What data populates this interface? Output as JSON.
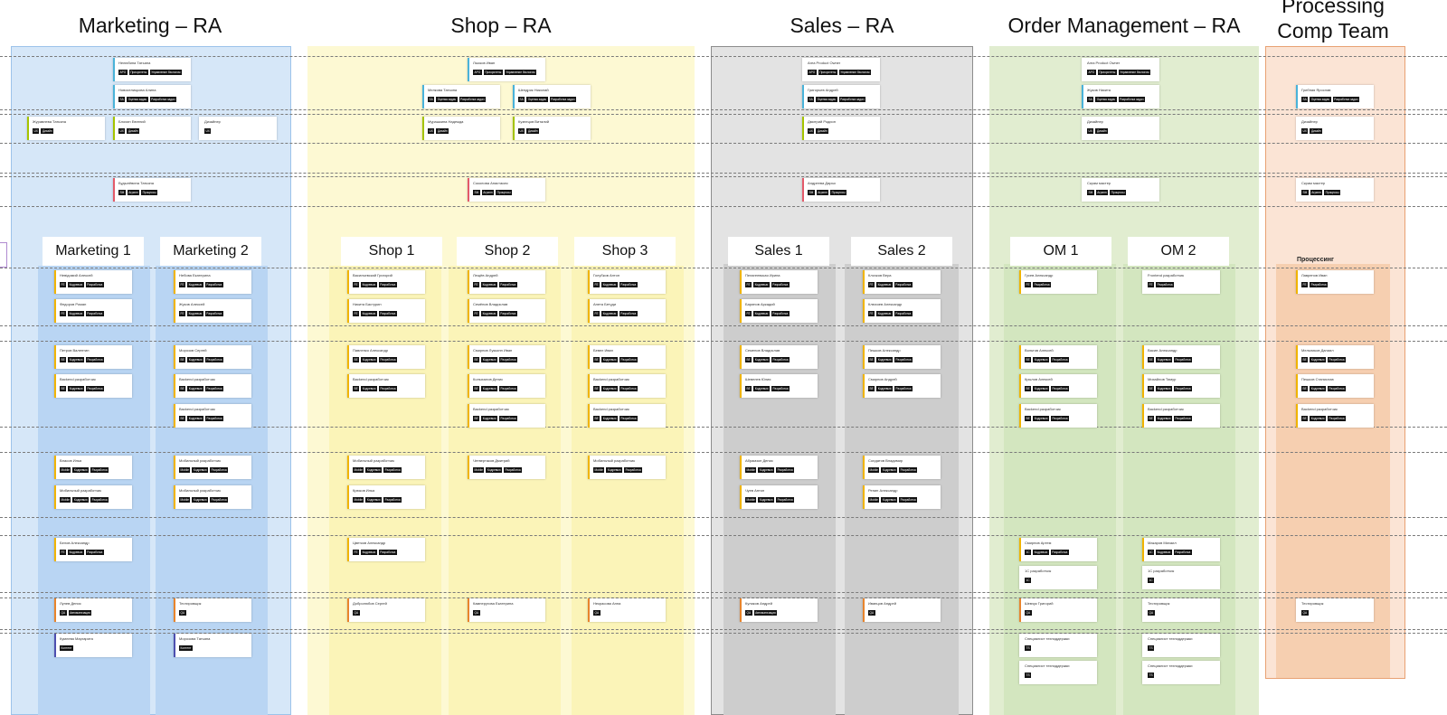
{
  "columns": [
    {
      "title": "Marketing – RA",
      "color": "#d6e7f8",
      "lane_color": "#bdd8f4"
    },
    {
      "title": "Shop – RA",
      "color": "#fdf9d3",
      "lane_color": "#fbf4b8"
    },
    {
      "title": "Sales – RA",
      "color": "#e3e3e3",
      "lane_color": "#cdcdcd"
    },
    {
      "title": "Order Management – RA",
      "color": "#e1edd0",
      "lane_color": "#d3e6bf"
    },
    {
      "title": "Processing Comp Team",
      "color": "#fbe4d5",
      "lane_color": "#f6cfb0"
    }
  ],
  "teams": [
    "Marketing 1",
    "Marketing 2",
    "Shop 1",
    "Shop 2",
    "Shop 3",
    "Sales 1",
    "Sales 2",
    "OM 1",
    "OM 2"
  ],
  "processing_label": "Процессинг",
  "cards": [
    {
      "name": "Нелюбина Татьяна",
      "tags": [
        "APO",
        "Приоритеты",
        "Управление бэклогом"
      ],
      "border": "#4ab3d9"
    },
    {
      "name": "Новоселицкова Алина",
      "tags": [
        "SA",
        "Оценка задач",
        "Разработка задач"
      ],
      "border": "#4ab3d9"
    },
    {
      "name": "Журавлева Татьяна",
      "tags": [
        "UX",
        "Дизайн"
      ],
      "border": "#a5c400"
    },
    {
      "name": "Блохин Евгений",
      "tags": [
        "UX",
        "Дизайн"
      ],
      "border": "#a5c400"
    },
    {
      "name": "Дизайнер",
      "tags": [
        "UX"
      ],
      "border": "#ffffff"
    },
    {
      "name": "Будылёвина Татьяна",
      "tags": [
        "SM",
        "Агрипн",
        "Процессы"
      ],
      "border": "#e35a6a"
    },
    {
      "name": "Лысков Иван",
      "tags": [
        "APO",
        "Приоритеты",
        "Управление бэклогом"
      ],
      "border": "#4ab3d9"
    },
    {
      "name": "Мелкова Татьяна",
      "tags": [
        "SA",
        "Оценка задач",
        "Разработка задач"
      ],
      "border": "#4ab3d9"
    },
    {
      "name": "Шендрик Николай",
      "tags": [
        "SA",
        "Оценка задач",
        "Разработка задач"
      ],
      "border": "#4ab3d9"
    },
    {
      "name": "Мурашкина Надежда",
      "tags": [
        "UX",
        "Дизайн"
      ],
      "border": "#a5c400"
    },
    {
      "name": "Кузнецов Виталий",
      "tags": [
        "UX",
        "Дизайн"
      ],
      "border": "#a5c400"
    },
    {
      "name": "Соколова Анастасия",
      "tags": [
        "SM",
        "Агрипн",
        "Процессы"
      ],
      "border": "#e35a6a"
    },
    {
      "name": "Area Product Owner",
      "tags": [
        "APO",
        "Приоритеты",
        "Управление бэклогом"
      ],
      "border": "#ffffff"
    },
    {
      "name": "Григорьев Андрей",
      "tags": [
        "SA",
        "Оценка задач",
        "Разработка задач"
      ],
      "border": "#4ab3d9"
    },
    {
      "name": "Дмитрий Родион",
      "tags": [
        "UX",
        "Дизайн"
      ],
      "border": "#a5c400"
    },
    {
      "name": "Андреева Дарья",
      "tags": [
        "SM",
        "Агрипн",
        "Процессы"
      ],
      "border": "#e35a6a"
    },
    {
      "name": "Area Product Owner",
      "tags": [
        "APO",
        "Приоритеты",
        "Управление бэклогом"
      ],
      "border": "#ffffff"
    },
    {
      "name": "Жуков Никита",
      "tags": [
        "SA",
        "Оценка задач",
        "Разработка задач"
      ],
      "border": "#4ab3d9"
    },
    {
      "name": "Дизайнер",
      "tags": [
        "UX",
        "Дизайн"
      ],
      "border": "#ffffff"
    },
    {
      "name": "Скрам мастер",
      "tags": [
        "SM",
        "Агрипн",
        "Процессы"
      ],
      "border": "#ffffff"
    },
    {
      "name": "Грибная Ярослав",
      "tags": [
        "SA",
        "Оценка задач",
        "Разработка задач"
      ],
      "border": "#4ab3d9"
    },
    {
      "name": "Дизайнер",
      "tags": [
        "UX",
        "Дизайн"
      ],
      "border": "#ffffff"
    },
    {
      "name": "Скрам мастер",
      "tags": [
        "SM",
        "Агрипн",
        "Процессы"
      ],
      "border": "#ffffff"
    },
    {
      "name": "Невідомий Алексей",
      "tags": [
        "FE",
        "Кодревью",
        "Разработка"
      ],
      "border": "#f0b400"
    },
    {
      "name": "Федоров Роман",
      "tags": [
        "FE",
        "Кодревью",
        "Разработка"
      ],
      "border": "#f0b400"
    },
    {
      "name": "Петров Валентин",
      "tags": [
        "BE",
        "Кодревью",
        "Разработка"
      ],
      "border": "#f0b400"
    },
    {
      "name": "Backend разработчик",
      "tags": [
        "BE",
        "Кодревью",
        "Разработка"
      ],
      "border": "#f0b400"
    },
    {
      "name": "Власов Илья",
      "tags": [
        "Mobile",
        "Кодревью",
        "Разработка"
      ],
      "border": "#f0b400"
    },
    {
      "name": "Мобильный разработчик",
      "tags": [
        "Mobile",
        "Кодревью",
        "Разработка"
      ],
      "border": "#f0b400"
    },
    {
      "name": "Белов Александр",
      "tags": [
        "FE",
        "Кодревью",
        "Разработка"
      ],
      "border": "#f0b400"
    },
    {
      "name": "Лунев Денис",
      "tags": [
        "QA",
        "Автоматизация"
      ],
      "border": "#e8842c"
    },
    {
      "name": "Кумлева Маргарита",
      "tags": [
        "Контент"
      ],
      "border": "#4d4fb0"
    },
    {
      "name": "Небова Екатерина",
      "tags": [
        "FE",
        "Кодревью",
        "Разработка"
      ],
      "border": "#f0b400"
    },
    {
      "name": "Жуков Алексей",
      "tags": [
        "FE",
        "Кодревью",
        "Разработка"
      ],
      "border": "#f0b400"
    },
    {
      "name": "Морозов Сергей",
      "tags": [
        "BE",
        "Кодревью",
        "Разработка"
      ],
      "border": "#f0b400"
    },
    {
      "name": "Backend разработчик",
      "tags": [
        "BE",
        "Кодревью",
        "Разработка"
      ],
      "border": "#f0b400"
    },
    {
      "name": "Backend разработчик",
      "tags": [
        "BE",
        "Кодревью",
        "Разработка"
      ],
      "border": "#f0b400"
    },
    {
      "name": "Мобильный разработчик",
      "tags": [
        "Mobile",
        "Кодревью",
        "Разработка"
      ],
      "border": "#f0b400"
    },
    {
      "name": "Мобильный разработчик",
      "tags": [
        "Mobile",
        "Кодревью",
        "Разработка"
      ],
      "border": "#f0b400"
    },
    {
      "name": "Тестировщик",
      "tags": [
        "QA"
      ],
      "border": "#e8842c"
    },
    {
      "name": "Морозова Татьяна",
      "tags": [
        "Контент"
      ],
      "border": "#4d4fb0"
    },
    {
      "name": "Васильевский Григорий",
      "tags": [
        "FE",
        "Кодревью",
        "Разработка"
      ],
      "border": "#f0b400"
    },
    {
      "name": "Никита Бастурин",
      "tags": [
        "FE",
        "Кодревью",
        "Разработка"
      ],
      "border": "#f0b400"
    },
    {
      "name": "Павленко Александр",
      "tags": [
        "BE",
        "Кодревью",
        "Разработка"
      ],
      "border": "#f0b400"
    },
    {
      "name": "Backend разработчик",
      "tags": [
        "BE",
        "Кодревью",
        "Разработка"
      ],
      "border": "#f0b400"
    },
    {
      "name": "Мобильный разработчик",
      "tags": [
        "Mobile",
        "Кодревью",
        "Разработка"
      ],
      "border": "#f0b400"
    },
    {
      "name": "Крюков Илья",
      "tags": [
        "Mobile",
        "Кодревью",
        "Разработка"
      ],
      "border": "#f0b400"
    },
    {
      "name": "Цветков Александр",
      "tags": [
        "FE",
        "Кодревью",
        "Разработка"
      ],
      "border": "#f0b400"
    },
    {
      "name": "Добролюбов Сергей",
      "tags": [
        "QA"
      ],
      "border": "#e8842c"
    },
    {
      "name": "Лещёв Андрей",
      "tags": [
        "FE",
        "Кодревью",
        "Разработка"
      ],
      "border": "#f0b400"
    },
    {
      "name": "Семёнов Владислав",
      "tags": [
        "FE",
        "Кодревью",
        "Разработка"
      ],
      "border": "#f0b400"
    },
    {
      "name": "Смирнов Лукьяпп Иван",
      "tags": [
        "BE",
        "Кодревью",
        "Разработка"
      ],
      "border": "#f0b400"
    },
    {
      "name": "Колыхалов Денис",
      "tags": [
        "BE",
        "Кодревью",
        "Разработка"
      ],
      "border": "#f0b400"
    },
    {
      "name": "Backend разработчик",
      "tags": [
        "BE",
        "Кодревью",
        "Разработка"
      ],
      "border": "#f0b400"
    },
    {
      "name": "Четвертаков Дмитрий",
      "tags": [
        "Mobile",
        "Кодревью",
        "Разработка"
      ],
      "border": "#f0b400"
    },
    {
      "name": "Камнеругова Екатерина",
      "tags": [
        "QA"
      ],
      "border": "#e8842c"
    },
    {
      "name": "Голубков Антон",
      "tags": [
        "FE",
        "Кодревью",
        "Разработка"
      ],
      "border": "#f0b400"
    },
    {
      "name": "Анета Бетуди",
      "tags": [
        "FE",
        "Кодревью",
        "Разработка"
      ],
      "border": "#f0b400"
    },
    {
      "name": "Бевел Иван",
      "tags": [
        "BE",
        "Кодревью",
        "Разработка"
      ],
      "border": "#f0b400"
    },
    {
      "name": "Backend разработчик",
      "tags": [
        "BE",
        "Кодревью",
        "Разработка"
      ],
      "border": "#f0b400"
    },
    {
      "name": "Backend разработчик",
      "tags": [
        "BE",
        "Кодревью",
        "Разработка"
      ],
      "border": "#f0b400"
    },
    {
      "name": "Мобильный разработчик",
      "tags": [
        "Mobile",
        "Кодревью",
        "Разработка"
      ],
      "border": "#f0b400"
    },
    {
      "name": "Некрасова Анна",
      "tags": [
        "QA"
      ],
      "border": "#e8842c"
    },
    {
      "name": "Пелагеевская Ирина",
      "tags": [
        "FE",
        "Кодревью",
        "Разработка"
      ],
      "border": "#f0b400"
    },
    {
      "name": "Баринов Аркадий",
      "tags": [
        "FE",
        "Кодревью",
        "Разработка"
      ],
      "border": "#f0b400"
    },
    {
      "name": "Семенов Владислав",
      "tags": [
        "BE",
        "Кодревью",
        "Разработка"
      ],
      "border": "#f0b400"
    },
    {
      "name": "Шевелев Юлия",
      "tags": [
        "BE",
        "Кодревью",
        "Разработка"
      ],
      "border": "#f0b400"
    },
    {
      "name": "Абрамзон Денис",
      "tags": [
        "Mobile",
        "Кодревью",
        "Разработка"
      ],
      "border": "#f0b400"
    },
    {
      "name": "Чуев Антон",
      "tags": [
        "Mobile",
        "Кодревью",
        "Разработка"
      ],
      "border": "#f0b400"
    },
    {
      "name": "Куликов Андрей",
      "tags": [
        "QA",
        "Автоматизация"
      ],
      "border": "#e8842c"
    },
    {
      "name": "Клочков Вера",
      "tags": [
        "FE",
        "Кодревью",
        "Разработка"
      ],
      "border": "#f0b400"
    },
    {
      "name": "Клюхоев Александр",
      "tags": [
        "FE",
        "Кодревью",
        "Разработка"
      ],
      "border": "#f0b400"
    },
    {
      "name": "Пешков Александр",
      "tags": [
        "BE",
        "Кодревью",
        "Разработка"
      ],
      "border": "#f0b400"
    },
    {
      "name": "Смирнов Андрей",
      "tags": [
        "BE",
        "Кодревью",
        "Разработка"
      ],
      "border": "#f0b400"
    },
    {
      "name": "Солдатов Владимир",
      "tags": [
        "Mobile",
        "Кодревью",
        "Разработка"
      ],
      "border": "#f0b400"
    },
    {
      "name": "Репин Александр",
      "tags": [
        "Mobile",
        "Кодревью",
        "Разработка"
      ],
      "border": "#f0b400"
    },
    {
      "name": "Иванцов Андрей",
      "tags": [
        "QA"
      ],
      "border": "#e8842c"
    },
    {
      "name": "Гусев Александр",
      "tags": [
        "FE",
        "Разработка"
      ],
      "border": "#f0b400"
    },
    {
      "name": "Вольтов Алексей",
      "tags": [
        "BE",
        "Кодревью",
        "Разработка"
      ],
      "border": "#f0b400"
    },
    {
      "name": "Крылов Алексей",
      "tags": [
        "BE",
        "Кодревью",
        "Разработка"
      ],
      "border": "#f0b400"
    },
    {
      "name": "Backend разработчик",
      "tags": [
        "BE",
        "Кодревью",
        "Разработка"
      ],
      "border": "#f0b400"
    },
    {
      "name": "Смирнов Артем",
      "tags": [
        "1C",
        "Кодревью",
        "Разработка"
      ],
      "border": "#f0b400"
    },
    {
      "name": "1С разработчик",
      "tags": [
        "1C"
      ],
      "border": "#ffffff"
    },
    {
      "name": "Шевчук Григорий",
      "tags": [
        "QA"
      ],
      "border": "#e8842c"
    },
    {
      "name": "Специалист техподдержки",
      "tags": [
        "TS"
      ],
      "border": "#ffffff"
    },
    {
      "name": "Специалист техподдержки",
      "tags": [
        "TS"
      ],
      "border": "#ffffff"
    },
    {
      "name": "Frontend разработчик",
      "tags": [
        "FE",
        "Разработка"
      ],
      "border": "#ffffff"
    },
    {
      "name": "Васин Александр",
      "tags": [
        "BE",
        "Кодревью",
        "Разработка"
      ],
      "border": "#f0b400"
    },
    {
      "name": "Михайлов Тимур",
      "tags": [
        "BE",
        "Кодревью",
        "Разработка"
      ],
      "border": "#f0b400"
    },
    {
      "name": "Backend разработчик",
      "tags": [
        "BE",
        "Кодревью",
        "Разработка"
      ],
      "border": "#f0b400"
    },
    {
      "name": "Макаров Михаил",
      "tags": [
        "1C",
        "Кодревью",
        "Разработка"
      ],
      "border": "#f0b400"
    },
    {
      "name": "1С разработчик",
      "tags": [
        "1C"
      ],
      "border": "#ffffff"
    },
    {
      "name": "Тестировщик",
      "tags": [
        "QA"
      ],
      "border": "#ffffff"
    },
    {
      "name": "Специалист техподдержки",
      "tags": [
        "TS"
      ],
      "border": "#ffffff"
    },
    {
      "name": "Специалист техподдержки",
      "tags": [
        "TS"
      ],
      "border": "#ffffff"
    },
    {
      "name": "Лавренов Иван",
      "tags": [
        "FE",
        "Разработка"
      ],
      "border": "#f0b400"
    },
    {
      "name": "Мельников Даниил",
      "tags": [
        "BE",
        "Кодревью",
        "Разработка"
      ],
      "border": "#f0b400"
    },
    {
      "name": "Пешков Станислав",
      "tags": [
        "BE",
        "Кодревью",
        "Разработка"
      ],
      "border": "#f0b400"
    },
    {
      "name": "Backend разработчик",
      "tags": [
        "BE",
        "Кодревью",
        "Разработка"
      ],
      "border": "#f0b400"
    },
    {
      "name": "Тестировщик",
      "tags": [
        "QA"
      ],
      "border": "#ffffff"
    }
  ]
}
